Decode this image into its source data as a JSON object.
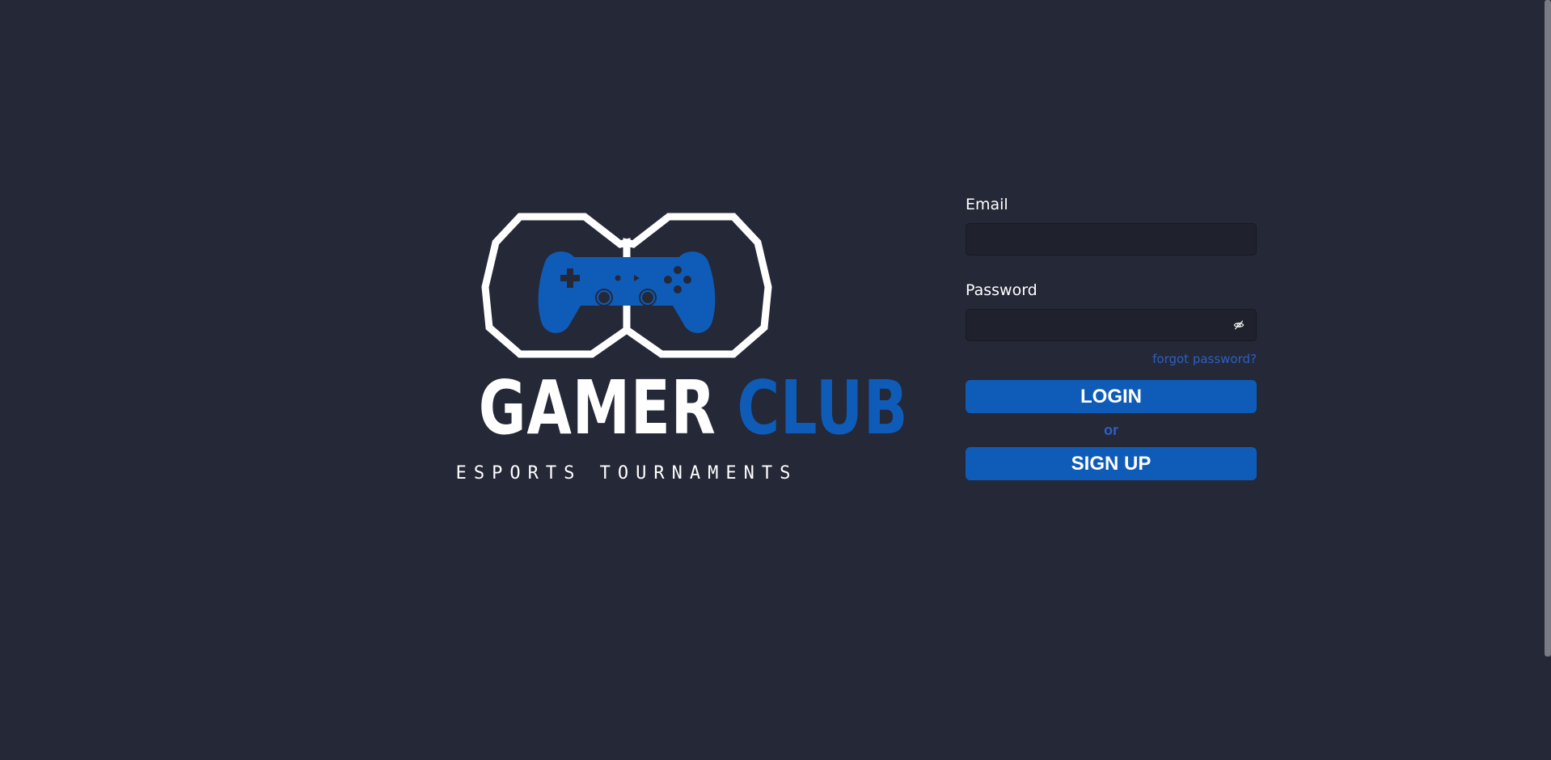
{
  "logo": {
    "word_primary": "GAMER",
    "word_secondary": "CLUB",
    "tagline": "ESPORTS TOURNAMENTS",
    "icon": "gamepad-icon",
    "colors": {
      "primary": "#ffffff",
      "accent": "#0f5cb8"
    }
  },
  "form": {
    "email_label": "Email",
    "email_value": "",
    "password_label": "Password",
    "password_value": "",
    "password_toggle_icon": "eye-off-icon",
    "forgot_link": "forgot password?",
    "login_button": "LOGIN",
    "separator": "or",
    "signup_button": "SIGN UP"
  },
  "theme": {
    "background": "#242837",
    "input_background": "#1f222d",
    "button": "#0f5cb8",
    "link": "#2d5fc6"
  }
}
